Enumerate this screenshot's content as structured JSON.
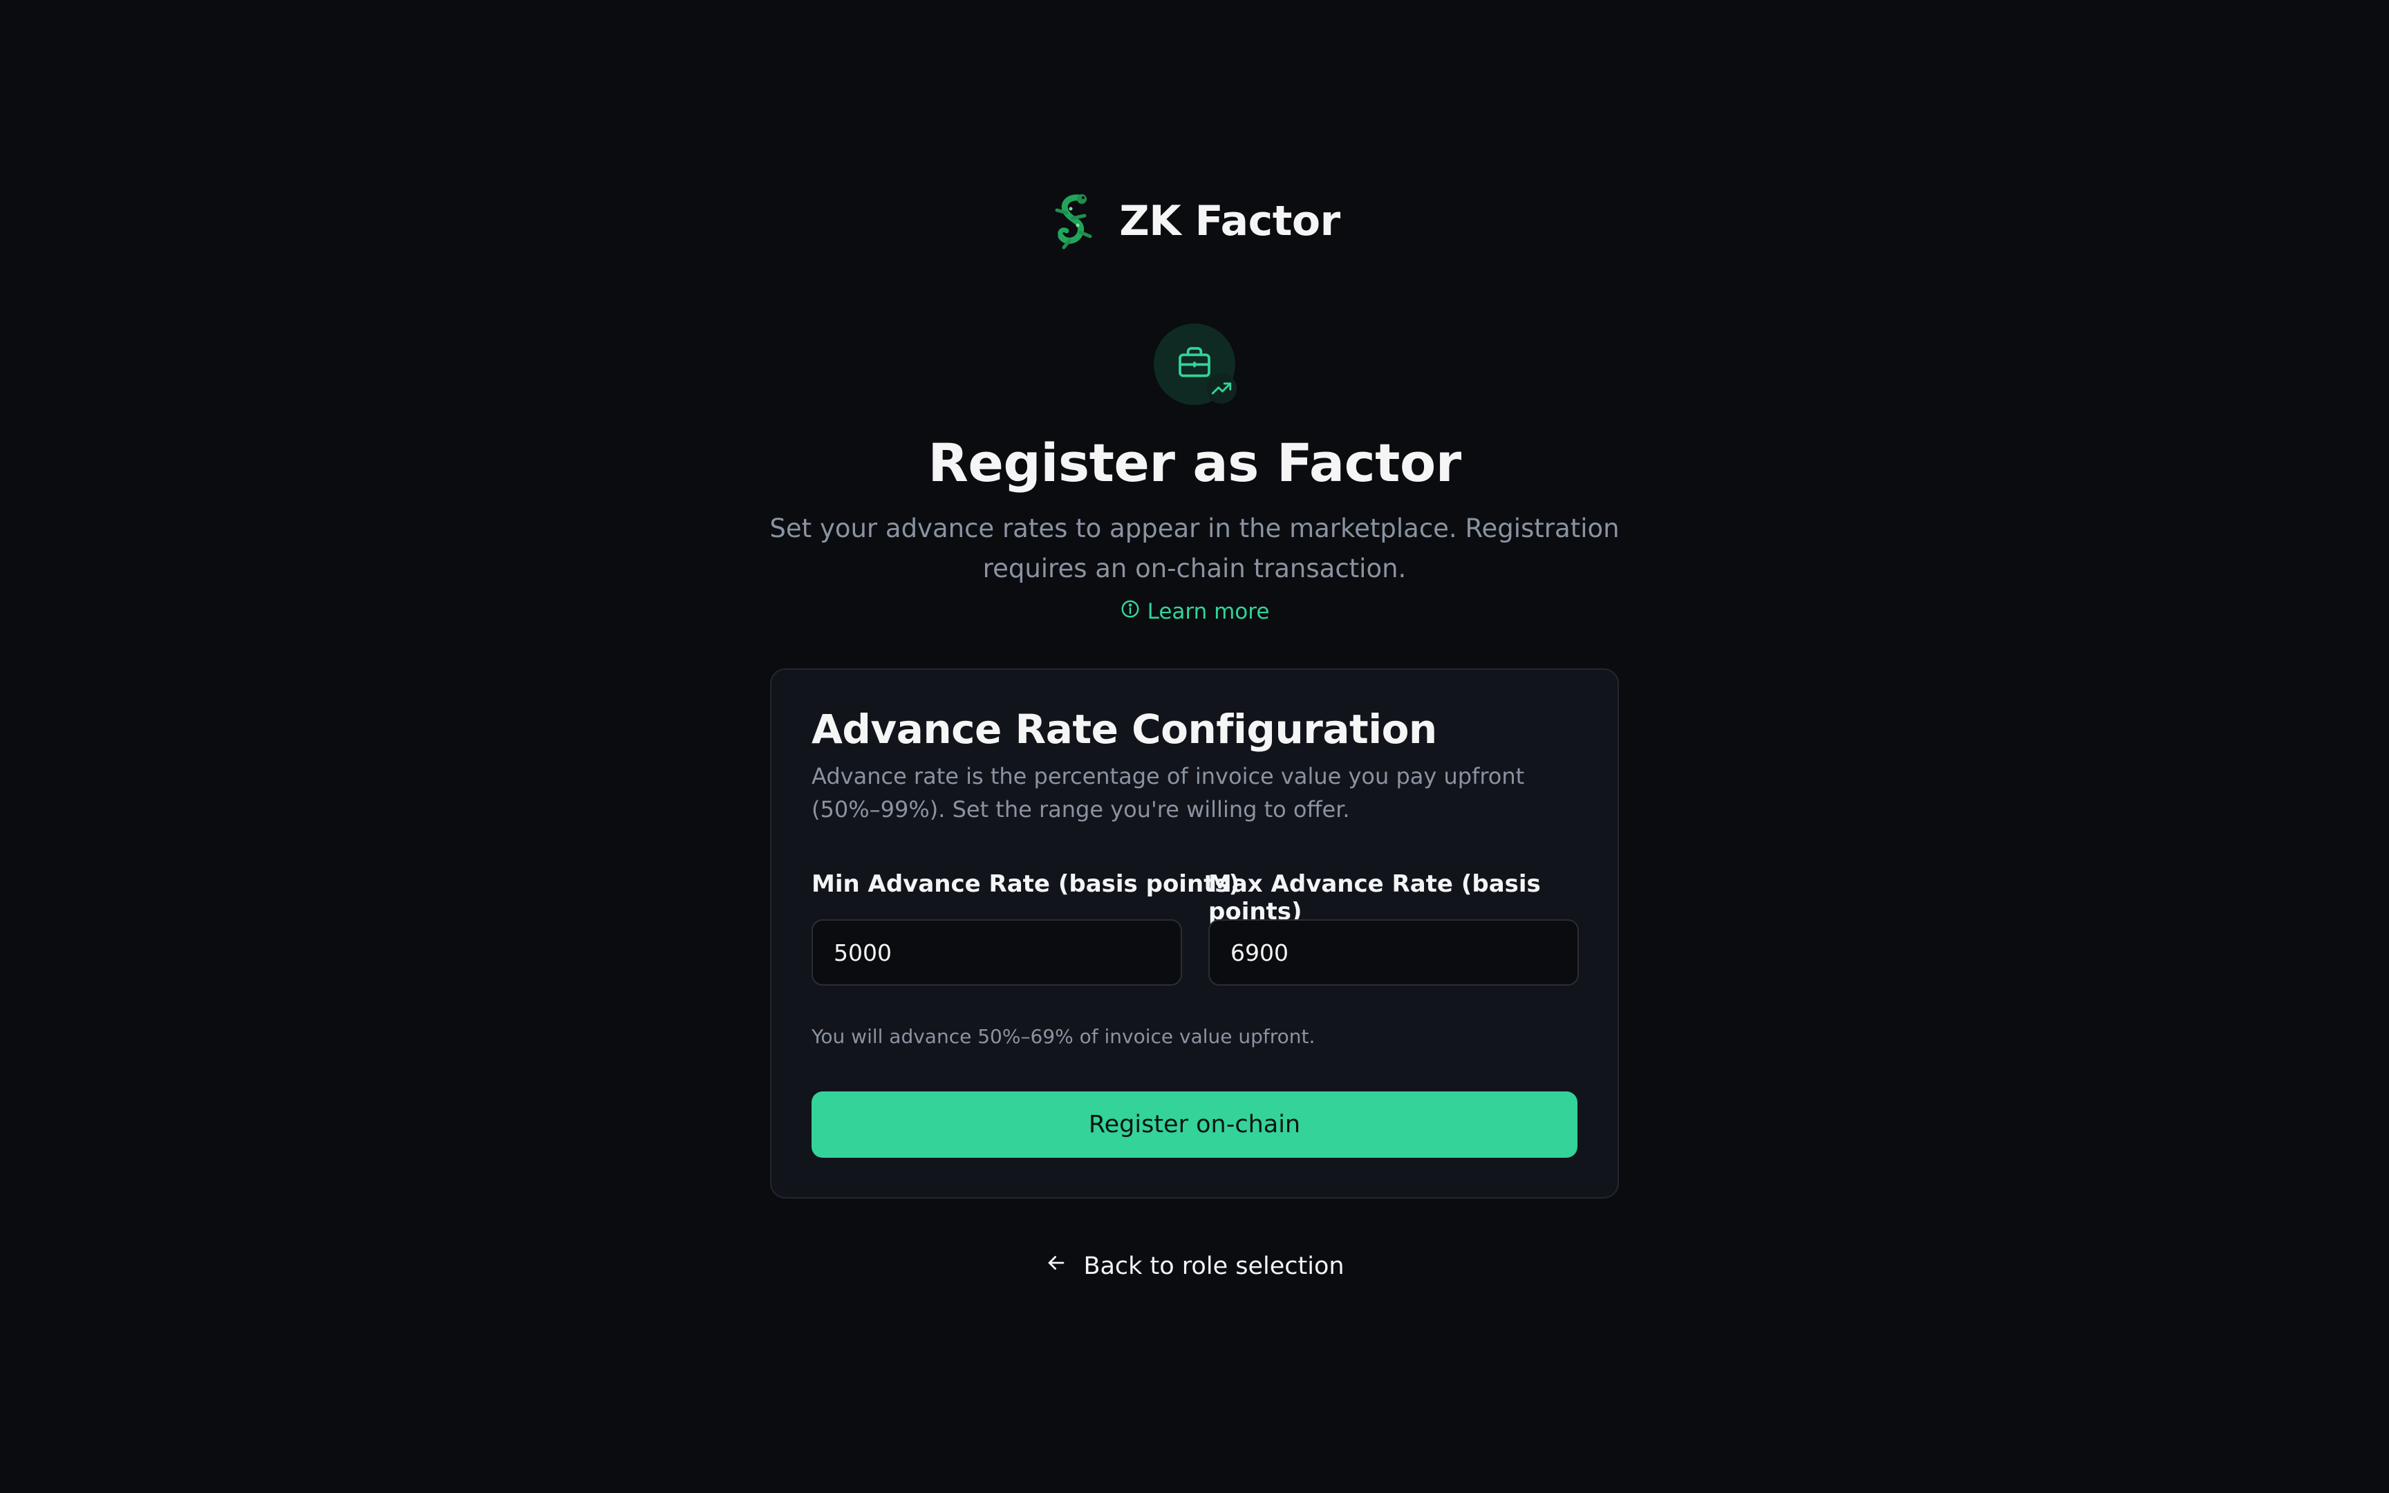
{
  "brand": {
    "name": "ZK Factor",
    "logo_icon": "gecko-logo-icon",
    "accent_color": "#34d399"
  },
  "hero": {
    "badge_icon": "briefcase-icon",
    "badge_sub_icon": "trending-up-icon",
    "title": "Register as Factor",
    "subtitle": "Set your advance rates to appear in the marketplace. Registration requires an on-chain transaction.",
    "learn_more_label": "Learn more",
    "learn_more_icon": "info-icon"
  },
  "card": {
    "title": "Advance Rate Configuration",
    "description": "Advance rate is the percentage of invoice value you pay upfront (50%–99%). Set the range you're willing to offer.",
    "min_label": "Min Advance Rate (basis points)",
    "min_value": "5000",
    "max_label": "Max Advance Rate (basis points)",
    "max_value": "6900",
    "hint": "You will advance 50%–69% of invoice value upfront.",
    "submit_label": "Register on-chain"
  },
  "footer": {
    "back_label": "Back to role selection",
    "back_icon": "arrow-left-icon"
  }
}
